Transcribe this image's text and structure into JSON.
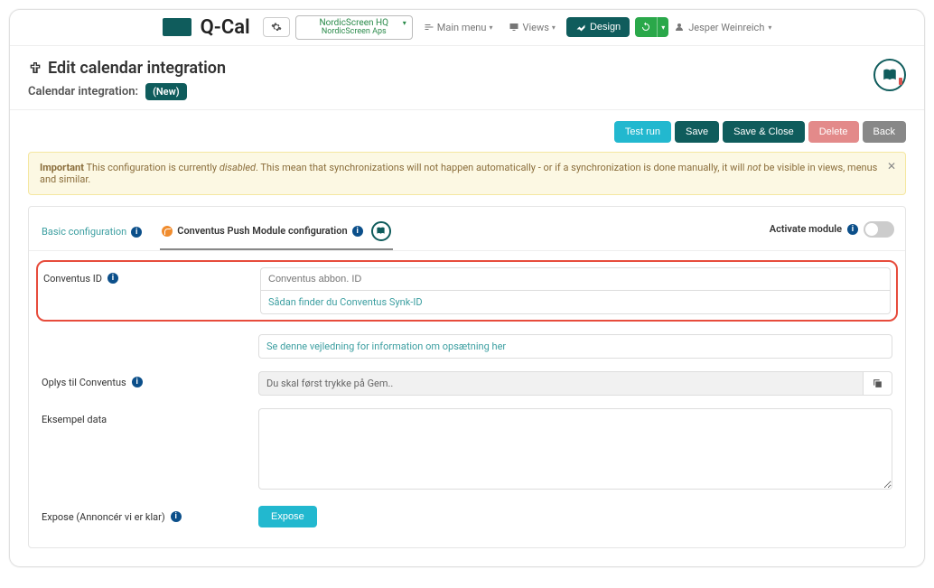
{
  "brand": {
    "name": "Q-Cal"
  },
  "org": {
    "name": "NordicScreen HQ",
    "sub": "NordicScreen Aps"
  },
  "nav": {
    "main_menu": "Main menu",
    "views": "Views",
    "design": "Design",
    "user": "Jesper Weinreich"
  },
  "header": {
    "title": "Edit calendar integration",
    "sub_label": "Calendar integration:",
    "new_badge": "(New)"
  },
  "buttons": {
    "test_run": "Test run",
    "save": "Save",
    "save_close": "Save & Close",
    "delete": "Delete",
    "back": "Back"
  },
  "alert": {
    "important": "Important",
    "text_a": "This configuration is currently ",
    "disabled_word": "disabled",
    "text_b": ". This mean that synchronizations will not happen automatically - or if a synchronization is done manually, it will ",
    "not_word": "not",
    "text_c": " be visible in views, menus and similar."
  },
  "tabs": {
    "basic": "Basic configuration",
    "conventus": "Conventus Push Module configuration",
    "activate_label": "Activate module"
  },
  "form": {
    "conventus_id_label": "Conventus ID",
    "conventus_id_placeholder": "Conventus abbon. ID",
    "conventus_id_help": "Sådan finder du Conventus Synk-ID",
    "setup_help": "Se denne vejledning for information om opsætning her",
    "oplys_label": "Oplys til Conventus",
    "oplys_value": "Du skal først trykke på Gem..",
    "eksempel_label": "Eksempel data",
    "expose_label": "Expose (Annoncér vi er klar)",
    "expose_button": "Expose"
  }
}
